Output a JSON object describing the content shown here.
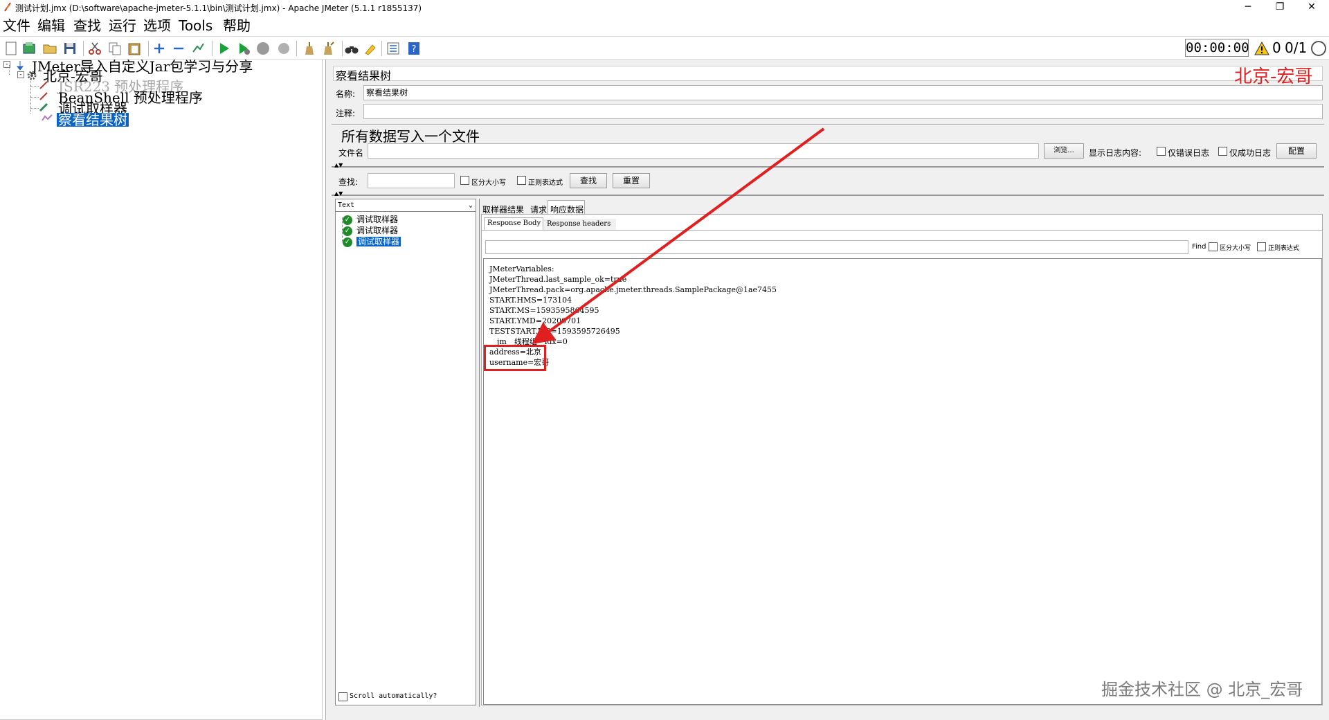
{
  "window": {
    "title": "测试计划.jmx (D:\\software\\apache-jmeter-5.1.1\\bin\\测试计划.jmx) - Apache JMeter (5.1.1 r1855137)",
    "controls": {
      "minimize": "─",
      "restore": "❐",
      "close": "✕"
    }
  },
  "menu": [
    "文件",
    "编辑",
    "查找",
    "运行",
    "选项",
    "Tools",
    "帮助"
  ],
  "toolbar": {
    "timer": "00:00:00",
    "warning_count": "0",
    "threads": "0/1"
  },
  "tree": {
    "root": "JMeter导入自定义Jar包学习与分享",
    "thread_group": "北京-宏哥",
    "children": [
      "JSR223 预处理程序",
      "BeanShell 预处理程序",
      "调试取样器",
      "察看结果树"
    ]
  },
  "panel": {
    "heading": "察看结果树",
    "watermark_top": "北京-宏哥",
    "name_label": "名称:",
    "name_value": "察看结果树",
    "comment_label": "注释:",
    "comment_value": "",
    "file_section_title": "所有数据写入一个文件",
    "filename_label": "文件名",
    "filename_value": "",
    "browse_button": "浏览...",
    "log_display_label": "显示日志内容:",
    "errors_only_label": "仅错误日志",
    "success_only_label": "仅成功日志",
    "configure_button": "配置"
  },
  "search": {
    "label": "查找:",
    "value": "",
    "case_label": "区分大小写",
    "regex_label": "正则表达式",
    "find_button": "查找",
    "reset_button": "重置"
  },
  "results": {
    "renderer": "Text",
    "samplers": [
      "调试取样器",
      "调试取样器",
      "调试取样器"
    ],
    "scroll_label": "Scroll automatically?",
    "tabs": [
      "取样器结果",
      "请求",
      "响应数据"
    ],
    "subtabs": [
      "Response Body",
      "Response headers"
    ],
    "find_label": "Find",
    "find_case_label": "区分大小写",
    "find_regex_label": "正则表达式",
    "lines": [
      "JMeterVariables:",
      "JMeterThread.last_sample_ok=true",
      "JMeterThread.pack=org.apache.jmeter.threads.SamplePackage@1ae7455",
      "START.HMS=173104",
      "START.MS=1593595864595",
      "START.YMD=20200701",
      "TESTSTART.MS=1593595726495",
      "__jm__线程组__idx=0",
      "address=北京",
      "username=宏哥"
    ]
  },
  "watermark_bottom": "掘金技术社区 @ 北京_宏哥",
  "colors": {
    "selection": "#0a64c8",
    "annotation_red": "#e02020",
    "ok_green": "#1e8a2a"
  }
}
